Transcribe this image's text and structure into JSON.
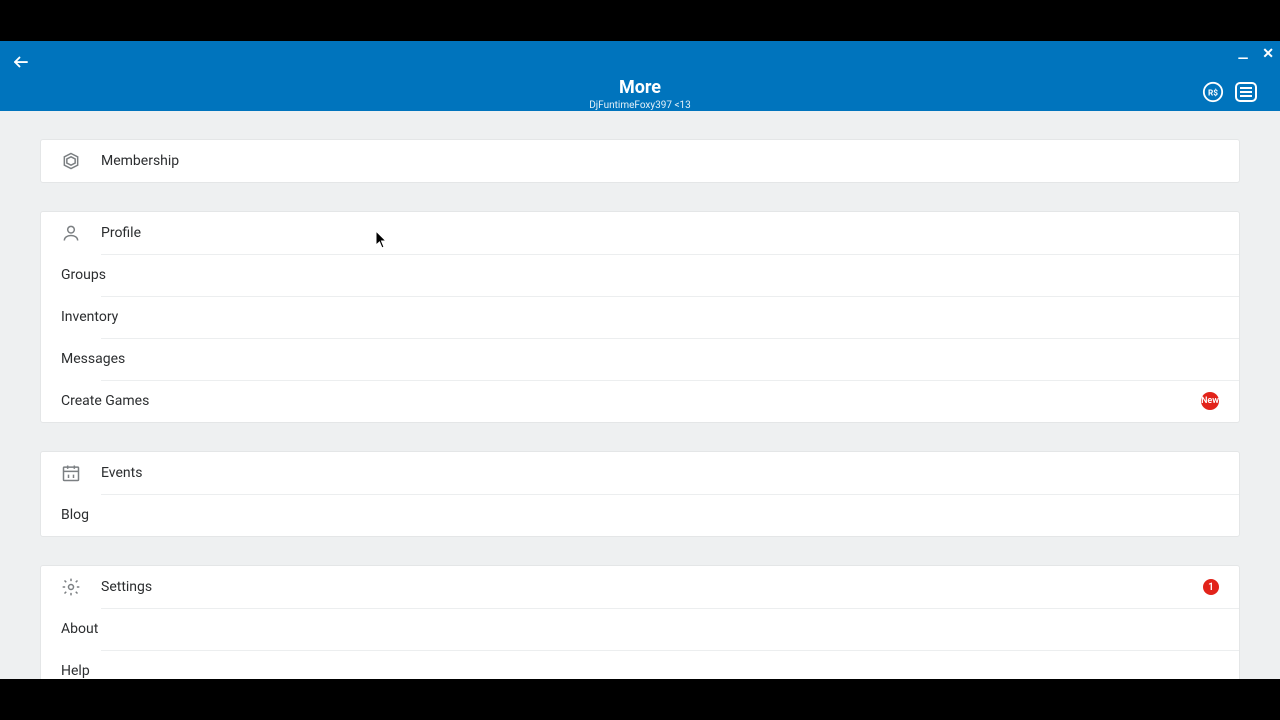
{
  "header": {
    "title": "More",
    "subtitle": "DjFuntimeFoxy397 <13"
  },
  "groups": [
    {
      "items": [
        {
          "icon": "membership",
          "label": "Membership"
        }
      ]
    },
    {
      "items": [
        {
          "icon": "profile",
          "label": "Profile"
        },
        {
          "icon": "groups",
          "label": "Groups"
        },
        {
          "icon": "inventory",
          "label": "Inventory"
        },
        {
          "icon": "messages",
          "label": "Messages"
        },
        {
          "icon": "create",
          "label": "Create Games",
          "badge_new": "New"
        }
      ]
    },
    {
      "items": [
        {
          "icon": "events",
          "label": "Events"
        },
        {
          "icon": "blog",
          "label": "Blog"
        }
      ]
    },
    {
      "items": [
        {
          "icon": "settings",
          "label": "Settings",
          "badge_count": "1"
        },
        {
          "icon": "about",
          "label": "About"
        },
        {
          "icon": "help",
          "label": "Help"
        }
      ]
    }
  ]
}
